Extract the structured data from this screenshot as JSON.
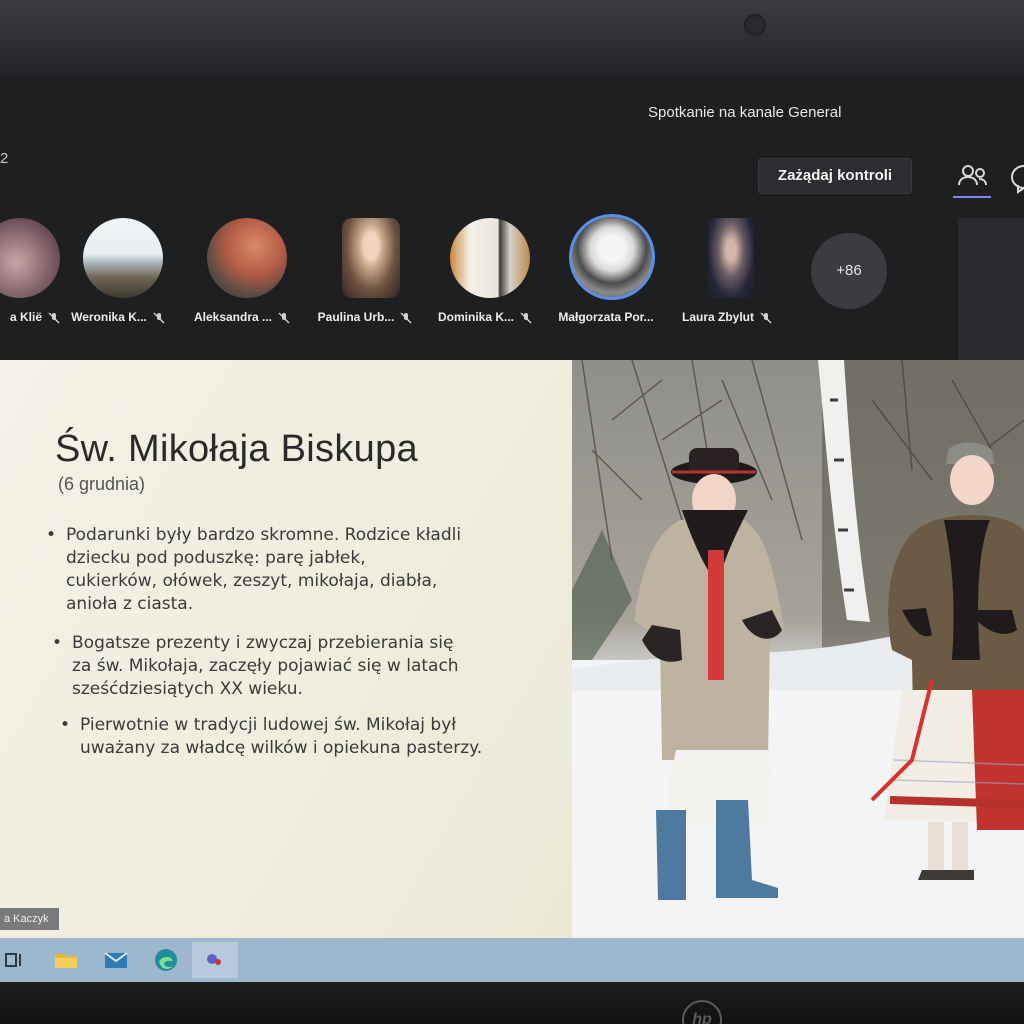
{
  "meeting": {
    "title": "Spotkanie na kanale General",
    "timer_fragment": "2",
    "request_control_label": "Zażądaj kontroli",
    "overflow_count": "+86"
  },
  "participants": [
    {
      "name": "a Klië"
    },
    {
      "name": "Weronika K..."
    },
    {
      "name": "Aleksandra ..."
    },
    {
      "name": "Paulina Urb..."
    },
    {
      "name": "Dominika K..."
    },
    {
      "name": "Małgorzata Por..."
    },
    {
      "name": "Laura Zbylut"
    }
  ],
  "slide": {
    "title": "Św. Mikołaja  Biskupa",
    "subtitle": "(6 grudnia)",
    "bullets": [
      {
        "lines": [
          "Podarunki były bardzo skromne.  Rodzice kładli",
          "dziecku pod poduszkę: parę jabłek,",
          "cukierków,  ołówek, zeszyt, mikołaja, diabła,",
          "anioła z ciasta."
        ]
      },
      {
        "lines": [
          "Bogatsze prezenty i zwyczaj przebierania się",
          "za św. Mikołaja, zaczęły pojawiać się w latach",
          "sześćdziesiątych XX wieku."
        ]
      },
      {
        "lines": [
          "Pierwotnie w tradycji ludowej św. Mikołaj był",
          "uważany za władcę wilków i opiekuna pasterzy."
        ]
      }
    ]
  },
  "presenter_tag": "a Kaczyk",
  "laptop_brand": "hp",
  "colors": {
    "teams_accent": "#7f85f5",
    "taskbar": "#9db7cc",
    "slide_bg": "#f3f0e2"
  }
}
